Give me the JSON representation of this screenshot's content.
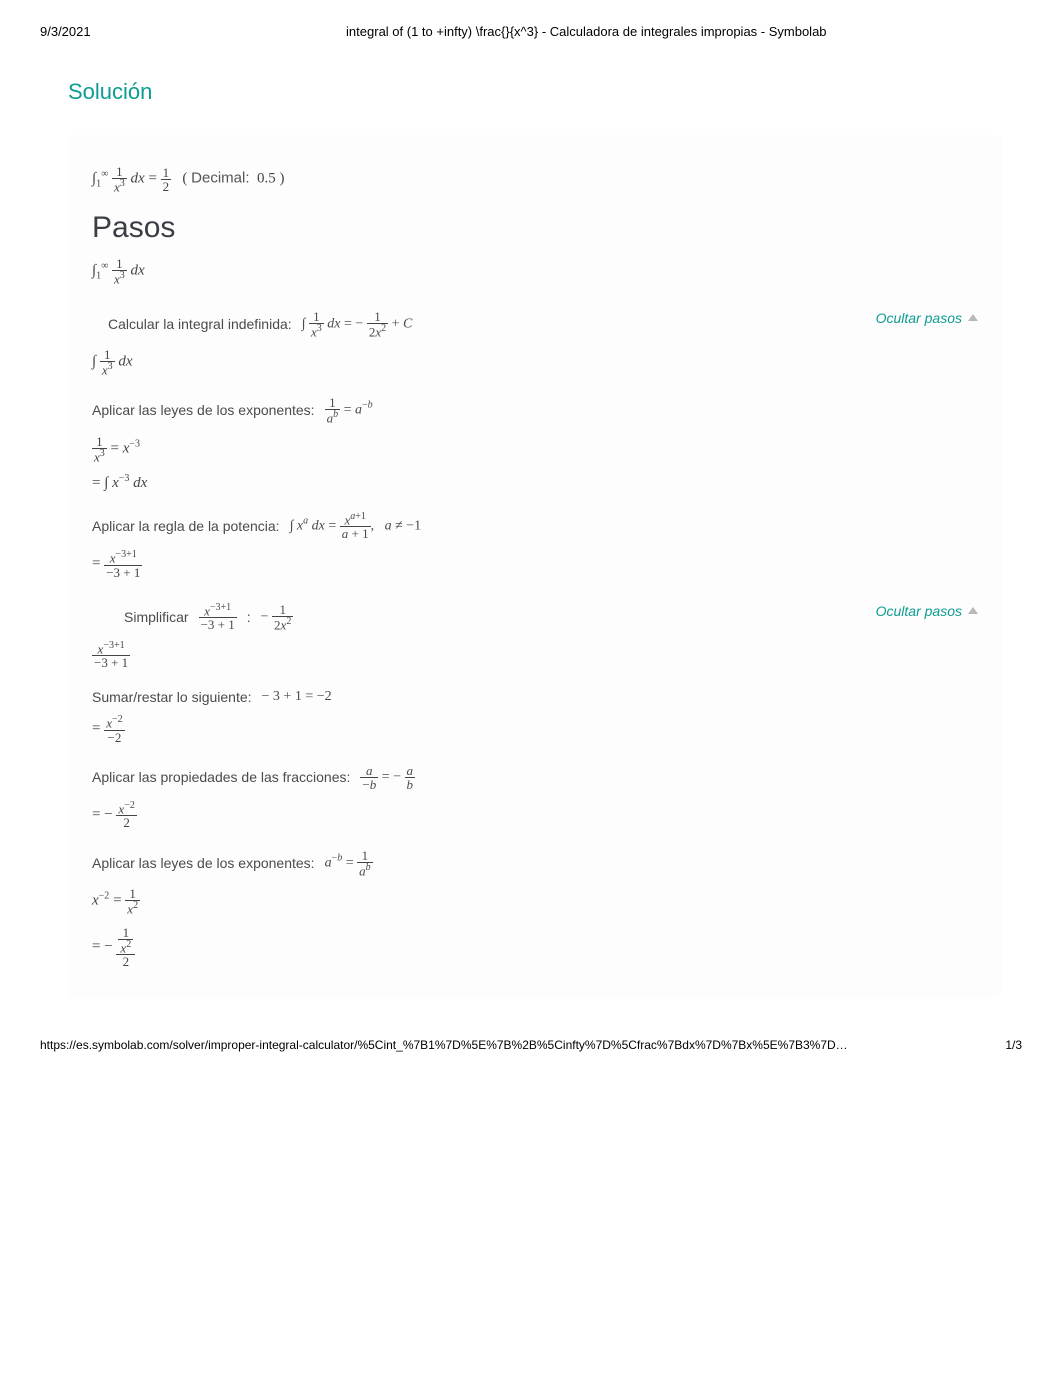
{
  "header": {
    "date": "9/3/2021",
    "title": "integral of (1 to +infty) \\frac{}{x^3} - Calculadora de integrales impropias - Symbolab"
  },
  "solution_heading": "Solución",
  "result": {
    "full_math": "∫₁^∞ 1/x³ dx = 1/2",
    "decimal_label": "Decimal:",
    "decimal_value": "0.5"
  },
  "steps_heading": "Pasos",
  "restated_math": "∫₁^∞ 1/x³ dx",
  "step1": {
    "label": "Calcular la integral indefinida:",
    "math": "∫ 1/x³ dx = − 1/(2x²) + C",
    "toggle": "Ocultar pasos"
  },
  "step1a": {
    "math": "∫ 1/x³ dx"
  },
  "step1b": {
    "label": "Aplicar las leyes de los exponentes:",
    "rule": "1/aᵇ = a⁻ᵇ",
    "line1": "1/x³ = x⁻³",
    "line2": "= ∫ x⁻³ dx"
  },
  "step1c": {
    "label": "Aplicar la regla de la potencia:",
    "rule": "∫ xᵃ dx = xᵃ⁺¹/(a+1),   a ≠ −1",
    "line1": "= x⁻³⁺¹ / (−3+1)"
  },
  "step1d": {
    "label": "Simplificar",
    "expr": "x⁻³⁺¹ / (−3+1)",
    "sep": ":",
    "result": "− 1/(2x²)",
    "toggle": "Ocultar pasos"
  },
  "step1d_lines": {
    "line0": "x⁻³⁺¹ / (−3+1)",
    "sum_label": "Sumar/restar lo siguiente:",
    "sum_math": "− 3 + 1 = −2",
    "line1": "= x⁻² / −2",
    "frac_label": "Aplicar las propiedades de las fracciones:",
    "frac_rule": "a/(−b) = −a/b",
    "line2": "= − x⁻² / 2",
    "exp_label": "Aplicar las leyes de los exponentes:",
    "exp_rule": "a⁻ᵇ = 1/aᵇ",
    "line3": "x⁻² = 1/x²",
    "line4": "= − (1/x²) / 2"
  },
  "footer": {
    "url": "https://es.symbolab.com/solver/improper-integral-calculator/%5Cint_%7B1%7D%5E%7B%2B%5Cinfty%7D%5Cfrac%7Bdx%7D%7Bx%5E%7B3%7D…",
    "page": "1/3"
  }
}
